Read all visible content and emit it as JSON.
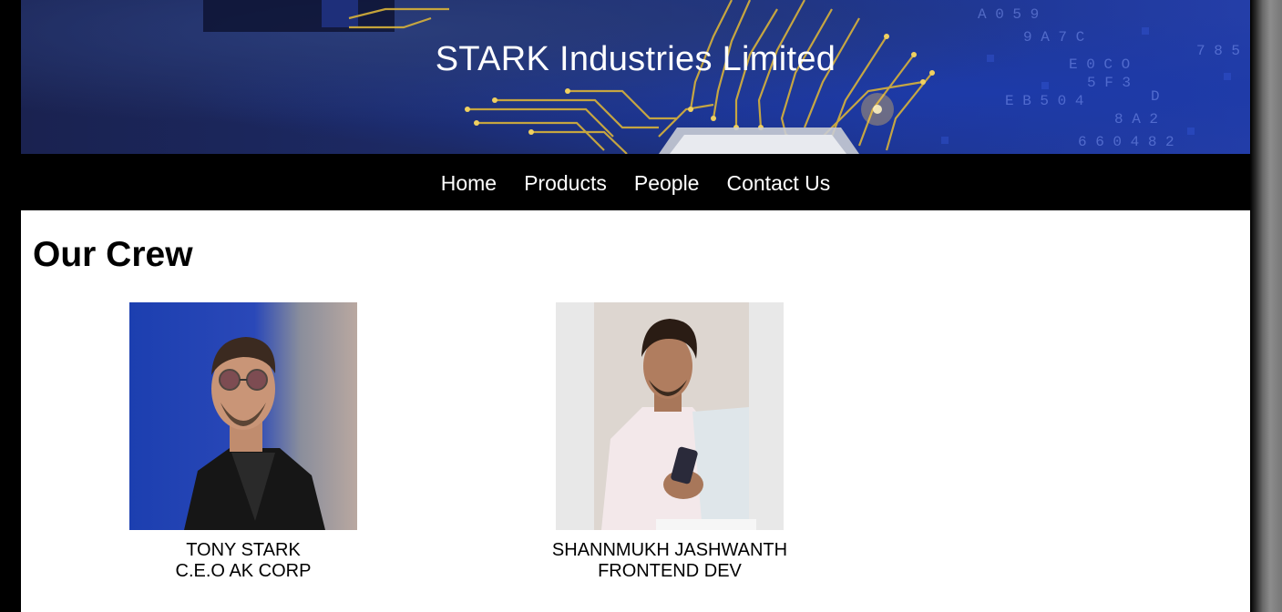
{
  "banner": {
    "title": "STARK Industries Limited"
  },
  "nav": {
    "items": [
      {
        "label": "Home"
      },
      {
        "label": "Products"
      },
      {
        "label": "People"
      },
      {
        "label": "Contact Us"
      }
    ]
  },
  "main": {
    "heading": "Our Crew",
    "members": [
      {
        "name": "TONY STARK",
        "role": "C.E.O AK CORP"
      },
      {
        "name": "SHANNMUKH JASHWANTH",
        "role": "FRONTEND DEV"
      }
    ]
  },
  "colors": {
    "nav_background": "#000000",
    "page_background": "#ffffff",
    "banner_text": "#ffffff"
  }
}
